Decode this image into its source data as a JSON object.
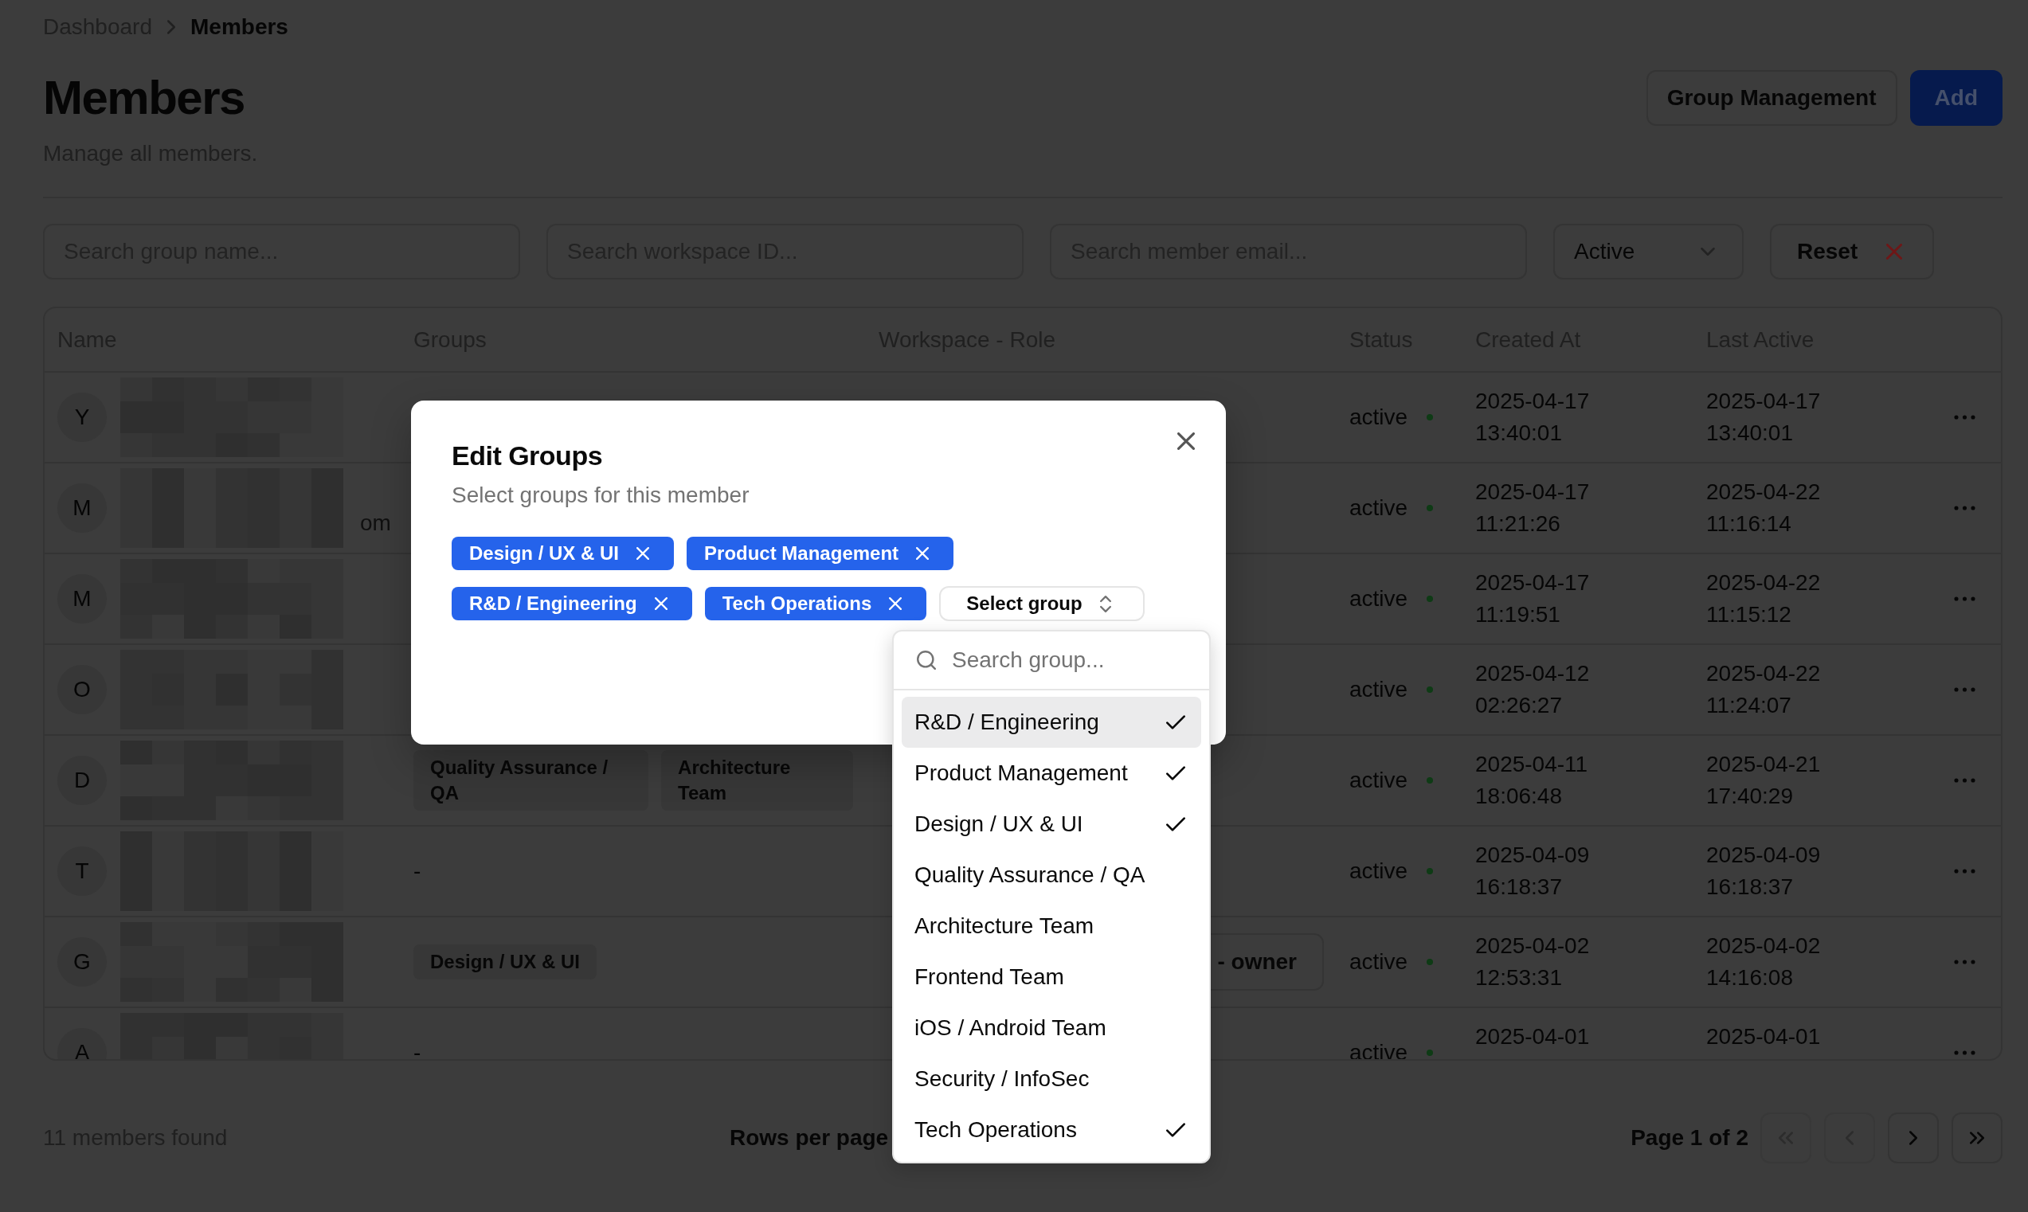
{
  "breadcrumb": [
    {
      "label": "Dashboard",
      "current": false
    },
    {
      "label": "Members",
      "current": true
    }
  ],
  "header": {
    "title": "Members",
    "subtitle": "Manage all members.",
    "buttons": [
      {
        "label": "Group Management",
        "kind": "outline"
      },
      {
        "label": "Add",
        "kind": "primary"
      }
    ]
  },
  "filters": [
    {
      "kind": "search",
      "placeholder": "Search group name..."
    },
    {
      "kind": "search",
      "placeholder": "Search workspace ID..."
    },
    {
      "kind": "search",
      "placeholder": "Search member email..."
    },
    {
      "kind": "select",
      "value": "Active"
    },
    {
      "kind": "reset",
      "label": "Reset"
    }
  ],
  "table": {
    "columns": [
      "Name",
      "Groups",
      "Workspace - Role",
      "Status",
      "Created At",
      "Last Active"
    ],
    "rows": [
      {
        "initial": "Y",
        "redacted": true,
        "status": "active",
        "created_at": "2025-04-17 13:40:01",
        "last_active": "2025-04-17 13:40:01"
      },
      {
        "initial": "M",
        "redacted": true,
        "email_tail": "om",
        "status": "active",
        "created_at": "2025-04-17 11:21:26",
        "last_active": "2025-04-22 11:16:14"
      },
      {
        "initial": "M",
        "redacted": true,
        "status": "active",
        "created_at": "2025-04-17 11:19:51",
        "last_active": "2025-04-22 11:15:12"
      },
      {
        "initial": "O",
        "redacted": true,
        "status": "active",
        "created_at": "2025-04-12 02:26:27",
        "last_active": "2025-04-22 11:24:07"
      },
      {
        "initial": "D",
        "redacted": true,
        "groups": [
          "Quality Assurance / QA",
          "Architecture Team"
        ],
        "status": "active",
        "created_at": "2025-04-11 18:06:48",
        "last_active": "2025-04-21 17:40:29"
      },
      {
        "initial": "T",
        "redacted": true,
        "groups_text": "-",
        "status": "active",
        "created_at": "2025-04-09 16:18:37",
        "last_active": "2025-04-09 16:18:37"
      },
      {
        "initial": "G",
        "redacted": true,
        "groups": [
          "Design / UX & UI"
        ],
        "workspace_role": "- owner",
        "status": "active",
        "created_at": "2025-04-02 12:53:31",
        "last_active": "2025-04-02 14:16:08"
      },
      {
        "initial": "A",
        "redacted": true,
        "groups_text": "-",
        "status": "active",
        "created_at": "2025-04-01",
        "last_active": "2025-04-01"
      }
    ]
  },
  "footer": {
    "count": "11 members found",
    "rows_per_page_label": "Rows per page",
    "page_label": "Page 1 of 2",
    "page_buttons": [
      {
        "kind": "first",
        "disabled": true
      },
      {
        "kind": "prev",
        "disabled": true
      },
      {
        "kind": "next",
        "disabled": false
      },
      {
        "kind": "last",
        "disabled": false
      }
    ]
  },
  "dialog": {
    "title": "Edit Groups",
    "description": "Select groups for this member",
    "selected_groups": [
      "Design / UX & UI",
      "Product Management",
      "R&D / Engineering",
      "Tech Operations"
    ],
    "select_button": "Select group",
    "dropdown": {
      "search_placeholder": "Search group...",
      "options": [
        {
          "label": "R&D / Engineering",
          "selected": true,
          "highlighted": true
        },
        {
          "label": "Product Management",
          "selected": true,
          "highlighted": false
        },
        {
          "label": "Design / UX & UI",
          "selected": true,
          "highlighted": false
        },
        {
          "label": "Quality Assurance / QA",
          "selected": false,
          "highlighted": false
        },
        {
          "label": "Architecture Team",
          "selected": false,
          "highlighted": false
        },
        {
          "label": "Frontend Team",
          "selected": false,
          "highlighted": false
        },
        {
          "label": "iOS / Android Team",
          "selected": false,
          "highlighted": false
        },
        {
          "label": "Security / InfoSec",
          "selected": false,
          "highlighted": false
        },
        {
          "label": "Tech Operations",
          "selected": true,
          "highlighted": false
        }
      ]
    }
  }
}
